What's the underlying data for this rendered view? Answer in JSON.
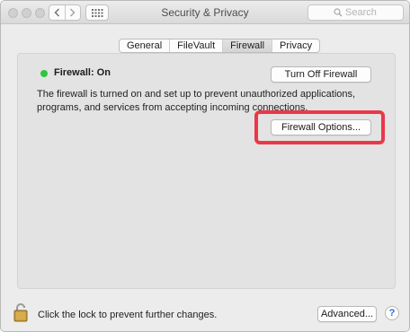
{
  "window": {
    "title": "Security & Privacy"
  },
  "toolbar": {
    "back_icon": "chevron-left-icon",
    "forward_icon": "chevron-right-icon",
    "show_all_icon": "grid-icon",
    "search_placeholder": "Search"
  },
  "tabs": [
    {
      "label": "General",
      "selected": false
    },
    {
      "label": "FileVault",
      "selected": false
    },
    {
      "label": "Firewall",
      "selected": true
    },
    {
      "label": "Privacy",
      "selected": false
    }
  ],
  "firewall": {
    "status_label": "Firewall: On",
    "status_color": "#2dc63c",
    "turn_off_button": "Turn Off Firewall",
    "description": "The firewall is turned on and set up to prevent unauthorized applications, programs, and services from accepting incoming connections.",
    "options_button": "Firewall Options...",
    "highlight_color": "#ea3849"
  },
  "footer": {
    "lock_text": "Click the lock to prevent further changes.",
    "advanced_button": "Advanced...",
    "help_label": "?"
  }
}
